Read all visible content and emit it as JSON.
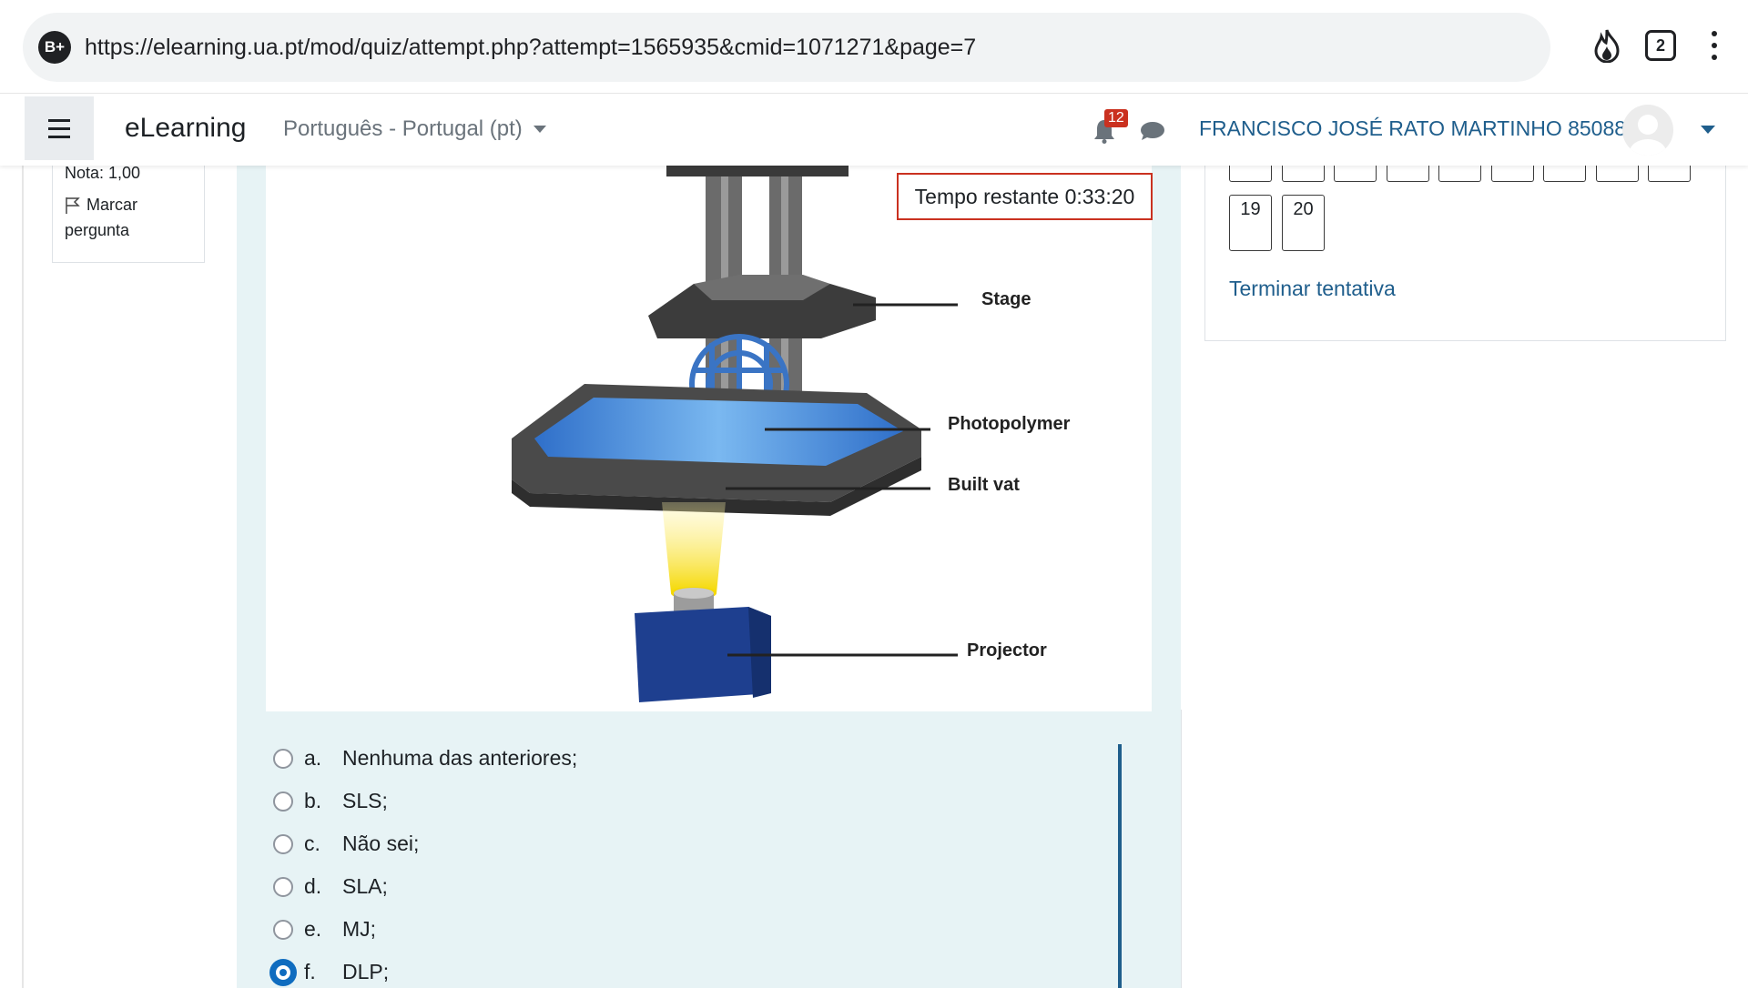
{
  "browser": {
    "site_badge": "B+",
    "url": "https://elearning.ua.pt/mod/quiz/attempt.php?attempt=1565935&cmid=1071271&page=7",
    "tab_count": "2"
  },
  "navbar": {
    "brand": "eLearning",
    "language": "Português - Portugal (pt)",
    "notification_count": "12",
    "user_name": "FRANCISCO JOSÉ RATO MARTINHO 85088"
  },
  "question_info": {
    "grade": "Nota: 1,00",
    "flag_label_line1": "Marcar",
    "flag_label_line2": "pergunta"
  },
  "timer": "Tempo restante 0:33:20",
  "figure": {
    "labels": [
      "Stage",
      "Photopolymer",
      "Built vat",
      "Projector"
    ]
  },
  "answers": [
    {
      "letter": "a.",
      "text": "Nenhuma das anteriores;",
      "selected": false
    },
    {
      "letter": "b.",
      "text": "SLS;",
      "selected": false
    },
    {
      "letter": "c.",
      "text": "Não sei;",
      "selected": false
    },
    {
      "letter": "d.",
      "text": "SLA;",
      "selected": false
    },
    {
      "letter": "e.",
      "text": "MJ;",
      "selected": false
    },
    {
      "letter": "f.",
      "text": "DLP;",
      "selected": true
    }
  ],
  "quiz_navigation": {
    "visible_numbers": [
      "19",
      "20"
    ],
    "finish_link": "Terminar tentativa"
  },
  "colors": {
    "link": "#1f5e8c",
    "timer_border": "#ca3120",
    "question_bg": "#e7f3f5",
    "selected_radio": "#0f6cbf"
  }
}
